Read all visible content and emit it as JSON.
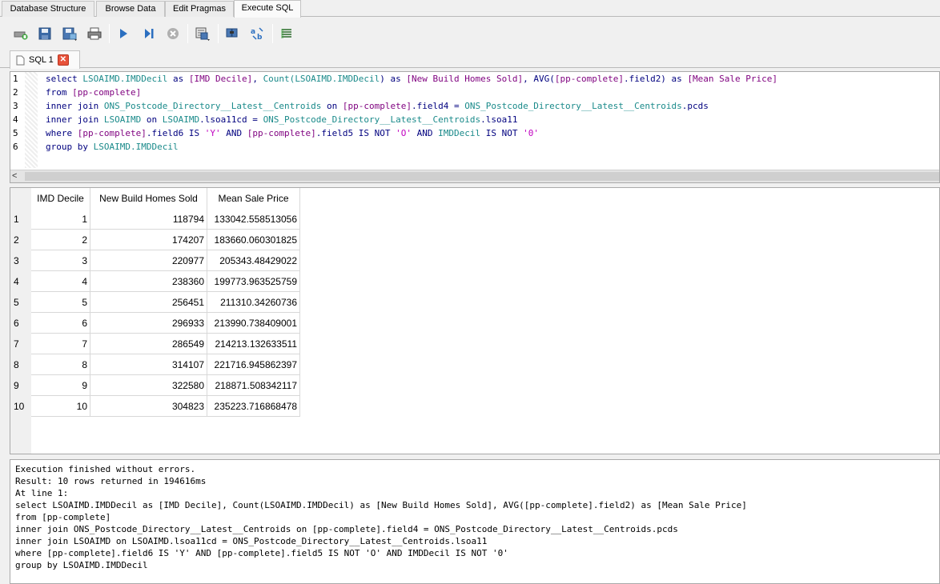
{
  "main_tabs": [
    {
      "label": "Database Structure"
    },
    {
      "label": "Browse Data"
    },
    {
      "label": "Edit Pragmas"
    },
    {
      "label": "Execute SQL"
    }
  ],
  "sql_tab": {
    "label": "SQL 1",
    "close": "✕"
  },
  "editor": {
    "line_numbers": [
      "1",
      "2",
      "3",
      "4",
      "5",
      "6"
    ],
    "lines": [
      [
        {
          "t": "select ",
          "c": "kw"
        },
        {
          "t": "LSOAIMD.IMDDecil",
          "c": "id"
        },
        {
          "t": " as ",
          "c": "kw"
        },
        {
          "t": "[IMD Decile]",
          "c": "br"
        },
        {
          "t": ", ",
          "c": "kw"
        },
        {
          "t": "Count(",
          "c": "id"
        },
        {
          "t": "LSOAIMD.IMDDecil",
          "c": "id"
        },
        {
          "t": ") as ",
          "c": "kw"
        },
        {
          "t": "[New Build Homes Sold]",
          "c": "br"
        },
        {
          "t": ", AVG(",
          "c": "kw"
        },
        {
          "t": "[pp-complete]",
          "c": "br"
        },
        {
          "t": ".field2) as ",
          "c": "kw"
        },
        {
          "t": "[Mean Sale Price]",
          "c": "br"
        }
      ],
      [
        {
          "t": "from ",
          "c": "kw"
        },
        {
          "t": "[pp-complete]",
          "c": "br"
        }
      ],
      [
        {
          "t": "inner join ",
          "c": "kw"
        },
        {
          "t": "ONS_Postcode_Directory__Latest__Centroids",
          "c": "id"
        },
        {
          "t": " on ",
          "c": "kw"
        },
        {
          "t": "[pp-complete]",
          "c": "br"
        },
        {
          "t": ".field4 = ",
          "c": "kw"
        },
        {
          "t": "ONS_Postcode_Directory__Latest__Centroids",
          "c": "id"
        },
        {
          "t": ".pcds",
          "c": "kw"
        }
      ],
      [
        {
          "t": "inner join ",
          "c": "kw"
        },
        {
          "t": "LSOAIMD",
          "c": "id"
        },
        {
          "t": " on ",
          "c": "kw"
        },
        {
          "t": "LSOAIMD",
          "c": "id"
        },
        {
          "t": ".lsoa11cd = ",
          "c": "kw"
        },
        {
          "t": "ONS_Postcode_Directory__Latest__Centroids",
          "c": "id"
        },
        {
          "t": ".lsoa11",
          "c": "kw"
        }
      ],
      [
        {
          "t": "where ",
          "c": "kw"
        },
        {
          "t": "[pp-complete]",
          "c": "br"
        },
        {
          "t": ".field6 IS ",
          "c": "kw"
        },
        {
          "t": "'Y'",
          "c": "st"
        },
        {
          "t": " AND ",
          "c": "kw"
        },
        {
          "t": "[pp-complete]",
          "c": "br"
        },
        {
          "t": ".field5 IS NOT ",
          "c": "kw"
        },
        {
          "t": "'O'",
          "c": "st"
        },
        {
          "t": " AND ",
          "c": "kw"
        },
        {
          "t": "IMDDecil",
          "c": "id"
        },
        {
          "t": " IS NOT ",
          "c": "kw"
        },
        {
          "t": "'0'",
          "c": "st"
        }
      ],
      [
        {
          "t": "group by ",
          "c": "kw"
        },
        {
          "t": "LSOAIMD.IMDDecil",
          "c": "id"
        }
      ]
    ],
    "scroll_left": "<"
  },
  "results": {
    "columns": [
      "IMD Decile",
      "New Build Homes Sold",
      "Mean Sale Price"
    ],
    "rows": [
      [
        "1",
        "1",
        "118794",
        "133042.558513056"
      ],
      [
        "2",
        "2",
        "174207",
        "183660.060301825"
      ],
      [
        "3",
        "3",
        "220977",
        "205343.48429022"
      ],
      [
        "4",
        "4",
        "238360",
        "199773.963525759"
      ],
      [
        "5",
        "5",
        "256451",
        "211310.34260736"
      ],
      [
        "6",
        "6",
        "296933",
        "213990.738409001"
      ],
      [
        "7",
        "7",
        "286549",
        "214213.132633511"
      ],
      [
        "8",
        "8",
        "314107",
        "221716.945862397"
      ],
      [
        "9",
        "9",
        "322580",
        "218871.508342117"
      ],
      [
        "10",
        "10",
        "304823",
        "235223.716868478"
      ]
    ]
  },
  "messages": [
    "Execution finished without errors.",
    "Result: 10 rows returned in 194616ms",
    "At line 1:",
    "select LSOAIMD.IMDDecil as [IMD Decile], Count(LSOAIMD.IMDDecil) as [New Build Homes Sold], AVG([pp-complete].field2) as [Mean Sale Price]",
    "from [pp-complete]",
    "inner join ONS_Postcode_Directory__Latest__Centroids on [pp-complete].field4 = ONS_Postcode_Directory__Latest__Centroids.pcds",
    "inner join LSOAIMD on LSOAIMD.lsoa11cd = ONS_Postcode_Directory__Latest__Centroids.lsoa11",
    "where [pp-complete].field6 IS 'Y' AND [pp-complete].field5 IS NOT 'O' AND IMDDecil IS NOT '0'",
    "group by LSOAIMD.IMDDecil"
  ],
  "toolbar_icons": [
    "open-tab-icon",
    "open-file-icon",
    "save-file-icon",
    "print-icon",
    "execute-all-icon",
    "execute-line-icon",
    "stop-icon",
    "save-results-icon",
    "find-icon",
    "find-replace-icon",
    "comment-icon"
  ]
}
